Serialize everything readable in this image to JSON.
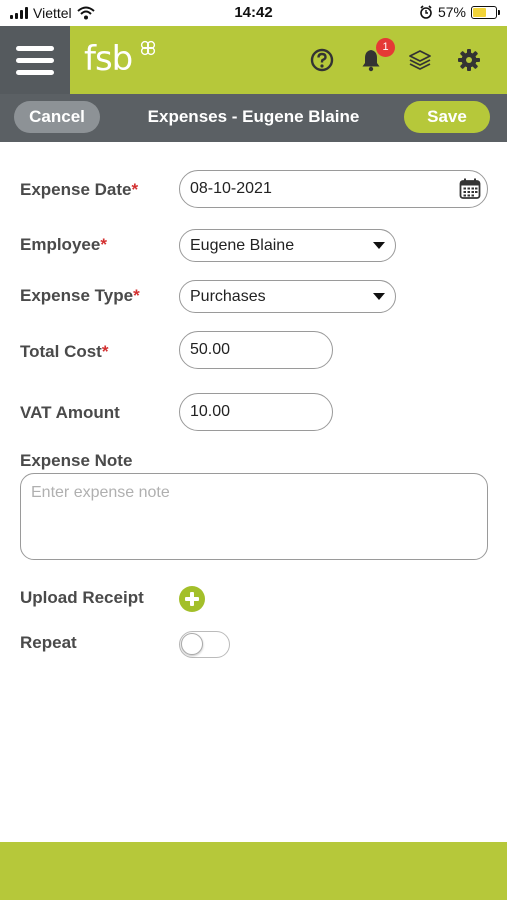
{
  "status_bar": {
    "carrier": "Viettel",
    "time": "14:42",
    "battery": "57%",
    "battery_level": 0.57
  },
  "header": {
    "logo_text": "fsb",
    "notification_count": "1",
    "icons": [
      "menu-icon",
      "help-icon",
      "bell-icon",
      "layers-icon",
      "gear-icon"
    ]
  },
  "titlebar": {
    "cancel_label": "Cancel",
    "title": "Expenses - Eugene Blaine",
    "save_label": "Save"
  },
  "form": {
    "expense_date": {
      "label": "Expense Date",
      "required": "*",
      "value": "08-10-2021"
    },
    "employee": {
      "label": "Employee",
      "required": "*",
      "value": "Eugene Blaine"
    },
    "expense_type": {
      "label": "Expense Type",
      "required": "*",
      "value": "Purchases"
    },
    "total_cost": {
      "label": "Total Cost",
      "required": "*",
      "value": "50.00"
    },
    "vat_amount": {
      "label": "VAT Amount",
      "value": "10.00"
    },
    "expense_note": {
      "label": "Expense Note",
      "placeholder": "Enter expense note"
    },
    "upload_receipt": {
      "label": "Upload Receipt"
    },
    "repeat": {
      "label": "Repeat",
      "on": false
    }
  },
  "colors": {
    "brand_green": "#b6c83a",
    "dark_grey": "#5b6064",
    "required_red": "#d32f2f",
    "badge_red": "#e53935"
  }
}
